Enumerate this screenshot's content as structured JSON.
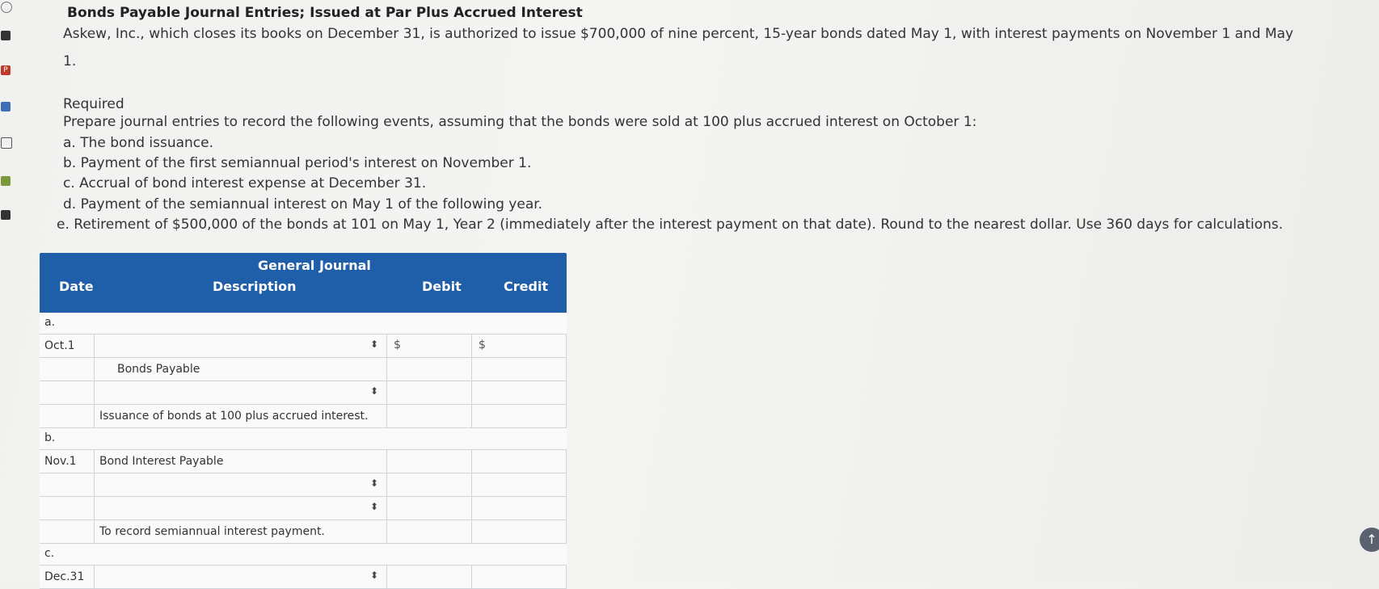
{
  "problem": {
    "title": "Bonds Payable Journal Entries; Issued at Par Plus Accrued Interest",
    "intro_line1": "Askew, Inc., which closes its books on December 31, is authorized to issue $700,000 of nine percent, 15-year bonds dated May 1, with interest payments on November 1 and May",
    "intro_line2": "1.",
    "required_label": "Required",
    "instruction": "Prepare journal entries to record the following events, assuming that the bonds were sold at 100 plus accrued interest on October 1:",
    "items": [
      "a. The bond issuance.",
      "b. Payment of the first semiannual period's interest on November 1.",
      "c. Accrual of bond interest expense at December 31.",
      "d. Payment of the semiannual interest on May 1 of the following year.",
      "e. Retirement of $500,000 of the bonds at 101 on May 1, Year 2 (immediately after the interest payment on that date). Round to the nearest dollar. Use 360 days for calculations."
    ]
  },
  "journal": {
    "title": "General Journal",
    "col_date": "Date",
    "col_description": "Description",
    "col_debit": "Debit",
    "col_credit": "Credit",
    "currency_symbol": "$",
    "section_a": "a.",
    "section_b": "b.",
    "section_c": "c.",
    "a_date": "Oct.1",
    "a_account2": "Bonds Payable",
    "a_memo": "Issuance of bonds at 100 plus accrued interest.",
    "b_date": "Nov.1",
    "b_account1": "Bond Interest Payable",
    "b_memo": "To record semiannual interest payment.",
    "c_date": "Dec.31"
  },
  "sidebar_icons": [
    "circle-icon",
    "sidebar-icon",
    "pdf-icon",
    "list-icon",
    "refresh-icon",
    "grid-icon",
    "arrow-icon"
  ],
  "colors": {
    "header_blue": "#1f5ea8",
    "background": "#f2f2f0"
  }
}
